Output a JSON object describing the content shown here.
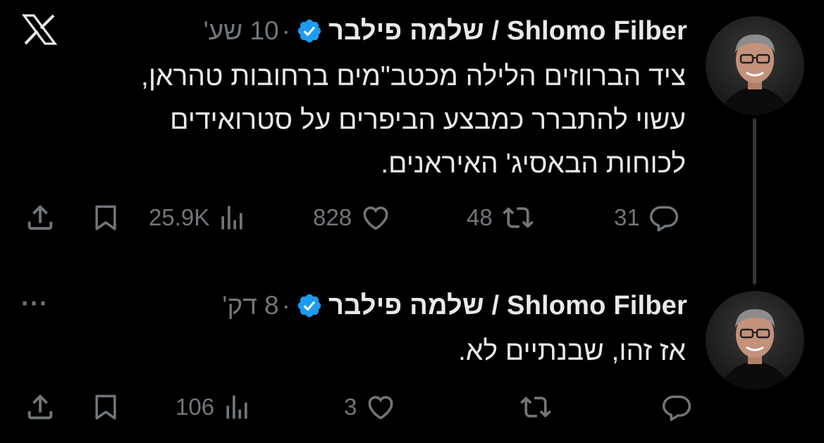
{
  "app": {
    "logo_icon": "x-logo-icon"
  },
  "colors": {
    "background": "#000000",
    "text": "#e7e9ea",
    "muted": "#71767b",
    "verified": "#1d9bf0",
    "thread_line": "#333639"
  },
  "tweets": [
    {
      "author": "Shlomo Filber / שלמה פילבר",
      "verified": true,
      "separator": "·",
      "time": "10 שע'",
      "text_lines": [
        "ציד הברווזים הלילה מכטב\"מים ברחובות טהראן,",
        "עשוי להתברר כמבצע הביפרים על סטרואידים",
        "לכוחות הבאסיג' האיראנים."
      ],
      "replies": "31",
      "retweets": "48",
      "likes": "828",
      "views": "25.9K"
    },
    {
      "author": "Shlomo Filber / שלמה פילבר",
      "verified": true,
      "separator": "·",
      "time": "8 דק'",
      "more_label": "···",
      "text_lines": [
        "אז זהו, שבנתיים לא."
      ],
      "replies": "",
      "retweets": "",
      "likes": "3",
      "views": "106"
    }
  ]
}
